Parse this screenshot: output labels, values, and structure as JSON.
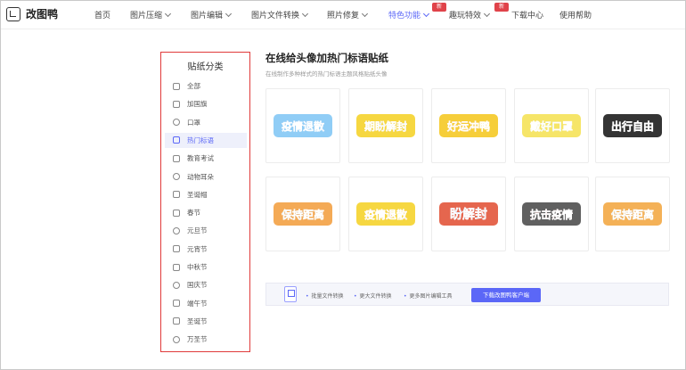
{
  "logo": {
    "text": "改图鸭"
  },
  "nav": [
    {
      "label": "首页",
      "chevron": false,
      "active": false
    },
    {
      "label": "图片压缩",
      "chevron": true,
      "active": false
    },
    {
      "label": "图片编辑",
      "chevron": true,
      "active": false
    },
    {
      "label": "图片文件转换",
      "chevron": true,
      "active": false
    },
    {
      "label": "照片修复",
      "chevron": true,
      "active": false
    },
    {
      "label": "特色功能",
      "chevron": true,
      "active": true
    },
    {
      "label": "趣玩特效",
      "chevron": true,
      "active": false
    },
    {
      "label": "下载中心",
      "chevron": false,
      "active": false
    },
    {
      "label": "使用帮助",
      "chevron": false,
      "active": false
    }
  ],
  "badges": [
    "新",
    "新"
  ],
  "sidebar": {
    "title": "贴纸分类",
    "items": [
      {
        "label": "全部",
        "icon": "grid-icon",
        "active": false
      },
      {
        "label": "加国旗",
        "icon": "flag-icon",
        "active": false
      },
      {
        "label": "口罩",
        "icon": "mask-icon",
        "active": false
      },
      {
        "label": "热门标语",
        "icon": "hot-slogan-icon",
        "active": true
      },
      {
        "label": "教育考试",
        "icon": "book-icon",
        "active": false
      },
      {
        "label": "动物耳朵",
        "icon": "animal-ear-icon",
        "active": false
      },
      {
        "label": "圣诞帽",
        "icon": "hat-icon",
        "active": false
      },
      {
        "label": "春节",
        "icon": "spring-festival-icon",
        "active": false
      },
      {
        "label": "元旦节",
        "icon": "calendar-icon",
        "active": false
      },
      {
        "label": "元宵节",
        "icon": "lantern-icon",
        "active": false
      },
      {
        "label": "中秋节",
        "icon": "moon-icon",
        "active": false
      },
      {
        "label": "国庆节",
        "icon": "national-flag-icon",
        "active": false
      },
      {
        "label": "端午节",
        "icon": "zongzi-icon",
        "active": false
      },
      {
        "label": "圣诞节",
        "icon": "christmas-tree-icon",
        "active": false
      },
      {
        "label": "万圣节",
        "icon": "pumpkin-icon",
        "active": false
      }
    ]
  },
  "main": {
    "title": "在线给头像加热门标语贴纸",
    "subtitle": "在线制作多种样式的热门标语主题风格贴纸头像"
  },
  "stickers": [
    {
      "text": "疫情退散",
      "color": "#2a6fd6",
      "accent": "#7cc4f5"
    },
    {
      "text": "期盼解封",
      "color": "#222222",
      "accent": "#f5d020"
    },
    {
      "text": "好运冲鸭",
      "color": "#e03a2f",
      "accent": "#f5c518"
    },
    {
      "text": "戴好口罩",
      "color": "#2b9b3a",
      "accent": "#f4e04d"
    },
    {
      "text": "出行自由",
      "color": "#ffffff",
      "accent": "#111111"
    },
    {
      "text": "保持距离",
      "color": "#2a8fd6",
      "accent": "#f29b38"
    },
    {
      "text": "疫情退散",
      "color": "#d63a8a",
      "accent": "#f5d020"
    },
    {
      "text": "盼解封",
      "color": "#1f5fd1",
      "accent": "#e04b2f"
    },
    {
      "text": "抗击疫情",
      "color": "#e0453a",
      "accent": "#444444"
    },
    {
      "text": "保持距离",
      "color": "#1f7fd1",
      "accent": "#f2a33a"
    }
  ],
  "download": {
    "logo_label": "改图鸭",
    "features": [
      "批量文件转换",
      "更大文件转换",
      "更多图片编辑工具"
    ],
    "button": "下载改图鸭客户端"
  }
}
